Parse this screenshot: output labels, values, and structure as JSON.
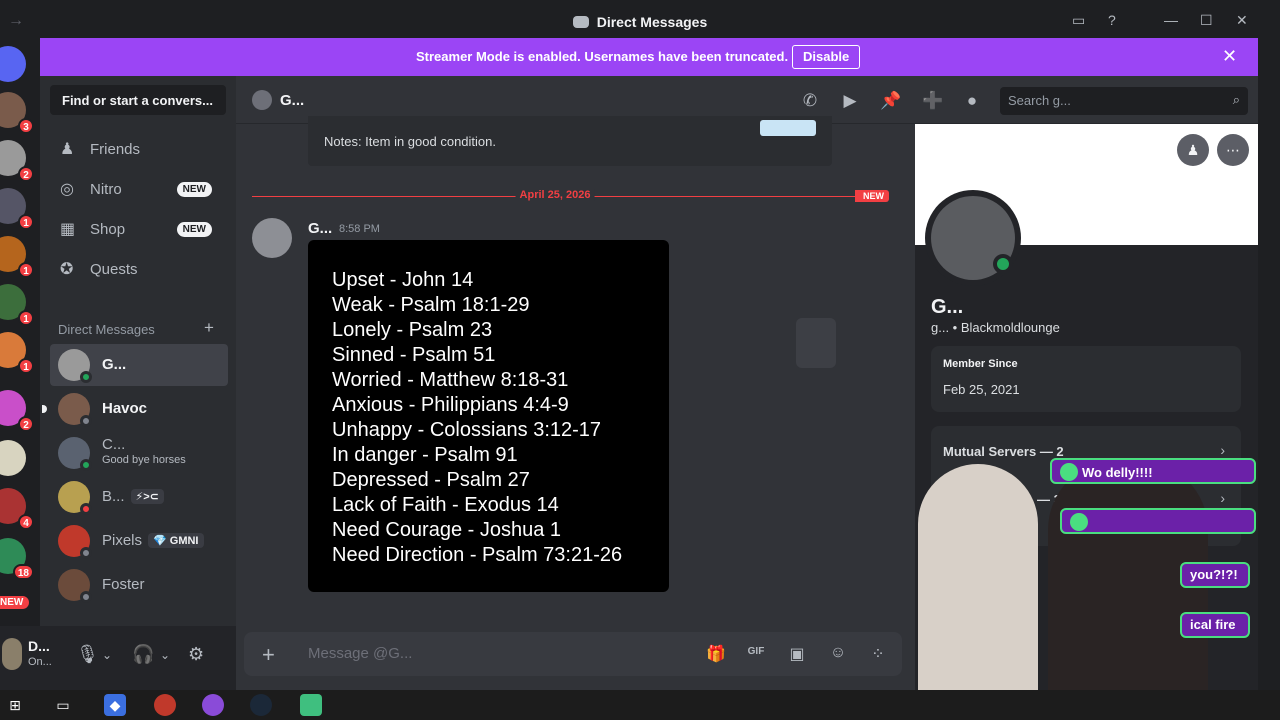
{
  "window": {
    "title": "Direct Messages"
  },
  "banner": {
    "text": "Streamer Mode is enabled. Usernames have been truncated.",
    "disable_label": "Disable"
  },
  "rail": {
    "badges": [
      "3",
      "2",
      "1",
      "1",
      "1",
      "1",
      "2",
      "4",
      "18"
    ],
    "new_label": "NEW"
  },
  "sidebar": {
    "search_placeholder": "Find or start a convers...",
    "nav": [
      {
        "label": "Friends",
        "icon": "friends-icon"
      },
      {
        "label": "Nitro",
        "icon": "nitro-icon",
        "badge": "NEW"
      },
      {
        "label": "Shop",
        "icon": "shop-icon",
        "badge": "NEW"
      },
      {
        "label": "Quests",
        "icon": "quests-icon"
      }
    ],
    "dm_header": "Direct Messages",
    "dms": [
      {
        "name": "G...",
        "status": "online"
      },
      {
        "name": "Havoc",
        "status": "offline"
      },
      {
        "name": "C...",
        "sub": "Good bye horses",
        "status": "online"
      },
      {
        "name": "B...",
        "tag": "⚡>⊂",
        "status": "dnd"
      },
      {
        "name": "Pixels",
        "tag": "💎 GMNI",
        "status": "offline"
      },
      {
        "name": "Foster",
        "status": "offline"
      }
    ]
  },
  "user": {
    "name": "D...",
    "status": "On..."
  },
  "header": {
    "name": "G...",
    "search_placeholder": "Search g..."
  },
  "chat": {
    "embed_notes": "Notes: Item in good condition.",
    "date_divider": "April 25, 2026",
    "new_label": "NEW",
    "message": {
      "author": "G...",
      "time": "8:58 PM",
      "image_lines": [
        "Upset - John 14",
        "Weak - Psalm 18:1-29",
        "Lonely - Psalm 23",
        "Sinned - Psalm 51",
        "Worried - Matthew 8:18-31",
        "Anxious - Philippians 4:4-9",
        "Unhappy - Colossians 3:12-17",
        "In danger - Psalm 91",
        "Depressed - Psalm 27",
        "Lack of Faith - Exodus 14",
        "Need Courage - Joshua 1",
        "Need Direction - Psalm 73:21-26"
      ]
    },
    "composer_placeholder": "Message @G..."
  },
  "profile": {
    "name": "G...",
    "username": "g... • Blackmoldlounge",
    "member_since_label": "Member Since",
    "member_since": "Feb 25, 2021",
    "mutual_servers": "Mutual Servers — 2",
    "mutual_friends_partial": "M",
    "mutual_friends_count": "— 3"
  },
  "overlay_chat": [
    {
      "text": "Wo            delly!!!!"
    },
    {
      "text": ""
    },
    {
      "text": "you?!?!"
    },
    {
      "text": "ical fire"
    }
  ],
  "colors": {
    "banner": "#9b45f5",
    "online": "#23a55a",
    "danger": "#f23f43",
    "background": "#313338"
  }
}
